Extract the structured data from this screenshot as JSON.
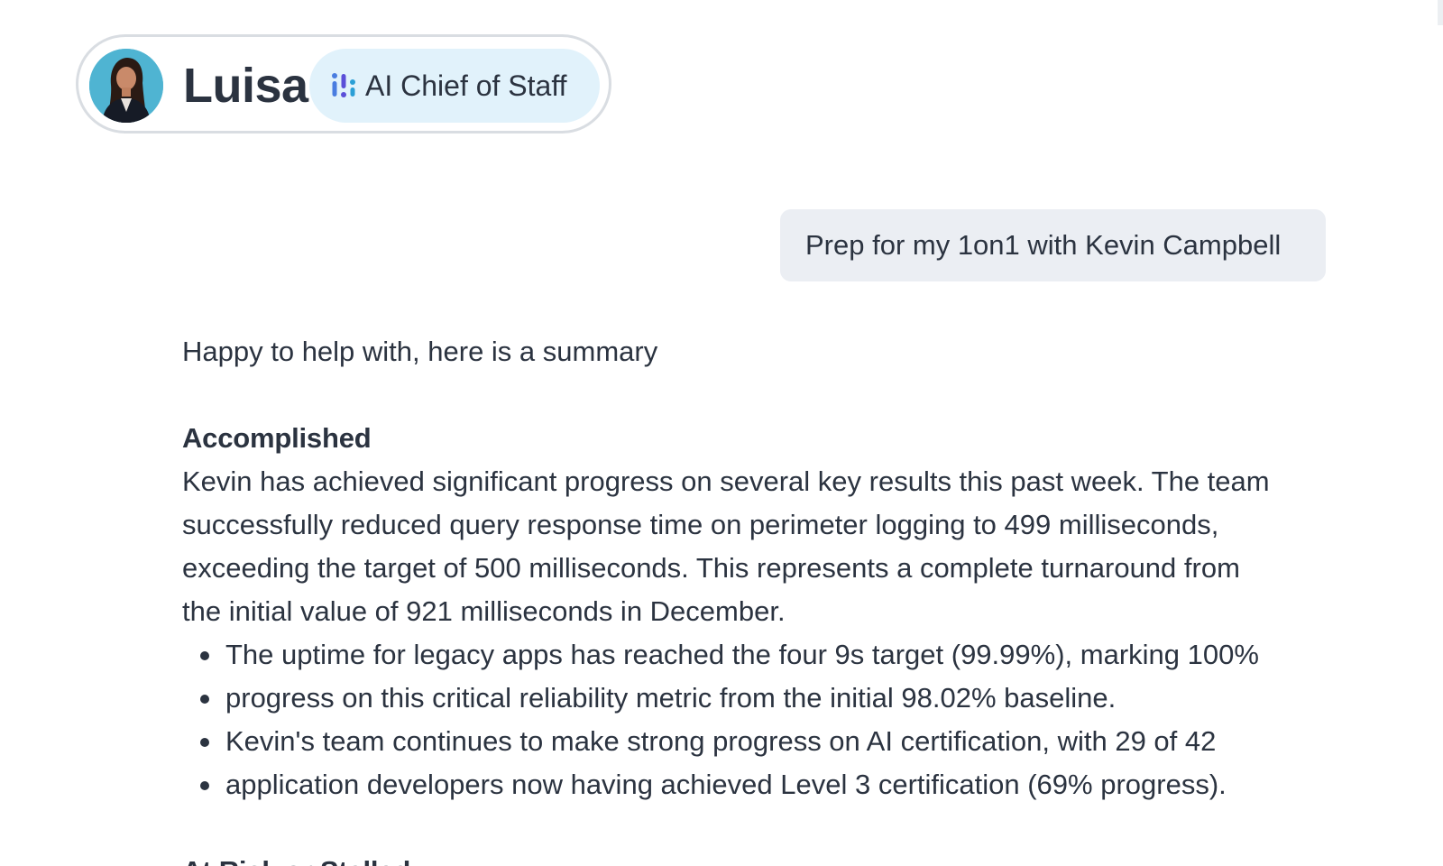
{
  "agent": {
    "name": "Luisa",
    "role": "AI Chief of Staff",
    "avatar_icon": "person-avatar-icon",
    "role_icon": "ai-sparkle-bars-icon",
    "accent_color": "#5b4fd8",
    "badge_color": "#e1f2fb"
  },
  "conversation": {
    "user_message": "Prep for my 1on1 with Kevin Campbell",
    "response": {
      "intro": "Happy to help with, here is a summary",
      "accomplished": {
        "title": "Accomplished",
        "paragraph_lines": [
          "Kevin has achieved significant progress on several key results this past week. The team",
          "successfully reduced query response time on perimeter logging to 499 milliseconds,",
          "exceeding the target of 500 milliseconds. This represents a complete turnaround from",
          "the initial value of 921 milliseconds in December."
        ],
        "bullets": [
          "The uptime for legacy apps has reached the four 9s target (99.99%), marking 100%",
          "progress on this critical reliability metric from the initial 98.02% baseline.",
          "Kevin's team continues to make strong progress on AI certification, with 29 of 42",
          "application developers now having achieved Level 3 certification (69% progress)."
        ]
      },
      "at_risk": {
        "title": "At Risk or Stalled"
      }
    }
  }
}
